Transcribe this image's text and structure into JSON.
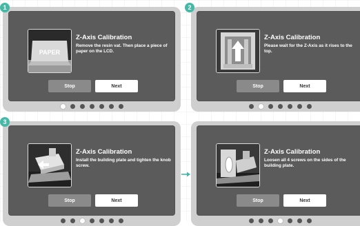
{
  "steps": [
    {
      "badge": "1",
      "title": "Z-Axis Calibration",
      "description": "Remove the resin vat. Then place a piece of paper on the LCD.",
      "image_label": "PAPER",
      "stop_label": "Stop",
      "next_label": "Next",
      "active_dot": 0
    },
    {
      "badge": "2",
      "title": "Z-Axis Calibration",
      "description": "Please wait for the Z-Axis as it rises to the top.",
      "stop_label": "Stop",
      "next_label": "Next",
      "active_dot": 1
    },
    {
      "badge": "3",
      "title": "Z-Axis Calibration",
      "description": "Install the building plate and tighten the knob screw.",
      "stop_label": "Stop",
      "next_label": "Next",
      "active_dot": 2
    },
    {
      "title": "Z-Axis Calibration",
      "description": "Loosen all 4 screws on the sides of the building plate.",
      "stop_label": "Stop",
      "next_label": "Next",
      "active_dot": 3
    }
  ],
  "dot_count": 7,
  "colors": {
    "badge": "#45b8a6",
    "arrow": "#45b8a6",
    "screen": "#5b5b5b",
    "panel": "#cfcfcf"
  }
}
